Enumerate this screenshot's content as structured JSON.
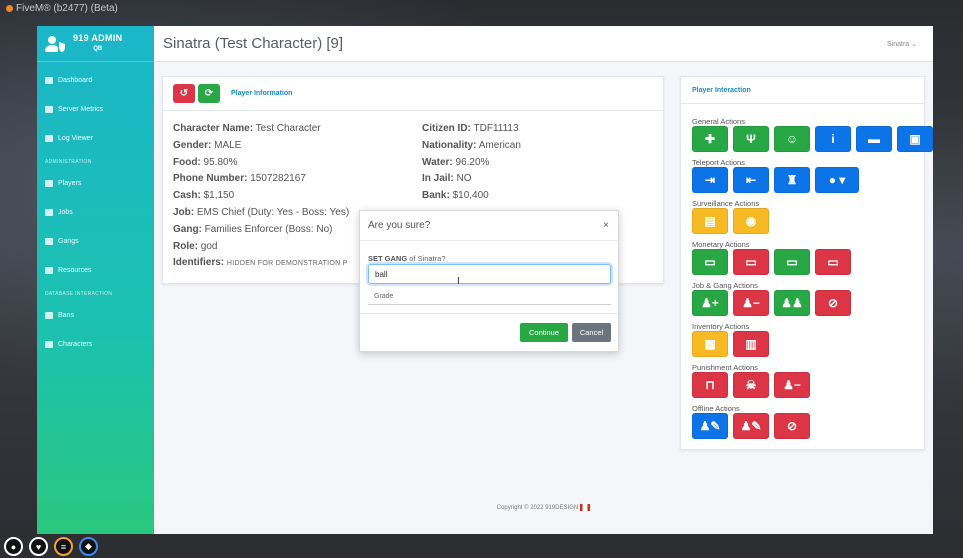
{
  "window_title": "FiveM® (b2477) (Beta)",
  "sidebar": {
    "brand_title": "919 ADMIN",
    "brand_sub": "QB",
    "items_top": [
      {
        "label": "Dashboard",
        "icon": "dashboard-icon"
      },
      {
        "label": "Server Metrics",
        "icon": "list-icon"
      },
      {
        "label": "Log Viewer",
        "icon": "file-icon"
      }
    ],
    "section_admin": "ADMINISTRATION",
    "items_admin": [
      {
        "label": "Players",
        "icon": "user-icon"
      },
      {
        "label": "Jobs",
        "icon": "briefcase-icon"
      },
      {
        "label": "Gangs",
        "icon": "users-icon"
      },
      {
        "label": "Resources",
        "icon": "folder-icon"
      }
    ],
    "section_db": "DATABASE INTERACTION",
    "items_db": [
      {
        "label": "Bans",
        "icon": "hammer-icon"
      },
      {
        "label": "Characters",
        "icon": "users-icon"
      }
    ]
  },
  "header": {
    "title": "Sinatra (Test Character) [9]",
    "user": "Sinatra"
  },
  "player_info": {
    "title": "Player Information",
    "left": [
      {
        "label": "Character Name:",
        "value": "Test Character"
      },
      {
        "label": "Gender:",
        "value": "MALE"
      },
      {
        "label": "Food:",
        "value": "95.80%"
      },
      {
        "label": "Phone Number:",
        "value": "1507282167"
      },
      {
        "label": "Cash:",
        "value": "$1,150"
      },
      {
        "label": "Job:",
        "value": "EMS Chief (Duty: Yes - Boss: Yes)"
      },
      {
        "label": "Gang:",
        "value": "Families Enforcer (Boss: No)"
      },
      {
        "label": "Role:",
        "value": "god"
      },
      {
        "label": "Identifiers:",
        "value": "HIDDEN FOR DEMONSTRATION P"
      }
    ],
    "right": [
      {
        "label": "Citizen ID:",
        "value": "TDF11113"
      },
      {
        "label": "Nationality:",
        "value": "American"
      },
      {
        "label": "Water:",
        "value": "96.20%"
      },
      {
        "label": "In Jail:",
        "value": "NO"
      },
      {
        "label": "Bank:",
        "value": "$10,400"
      }
    ]
  },
  "interaction": {
    "title": "Player Interaction",
    "groups": [
      {
        "label": "General Actions",
        "buttons": [
          {
            "icon": "medkit-icon",
            "color": "#28a745"
          },
          {
            "icon": "utensils-icon",
            "color": "#28a745"
          },
          {
            "icon": "smile-icon",
            "color": "#28a745"
          },
          {
            "icon": "info-icon",
            "color": "#0d74e8"
          },
          {
            "icon": "car-icon",
            "color": "#0d74e8"
          },
          {
            "icon": "save-icon",
            "color": "#0d74e8"
          }
        ]
      },
      {
        "label": "Teleport Actions",
        "buttons": [
          {
            "icon": "sign-in-icon",
            "color": "#0d74e8"
          },
          {
            "icon": "sign-out-icon",
            "color": "#0d74e8"
          },
          {
            "icon": "hiking-icon",
            "color": "#0d74e8"
          },
          {
            "icon": "map-pin-dropdown-icon",
            "color": "#0d74e8"
          }
        ]
      },
      {
        "label": "Surveillance Actions",
        "buttons": [
          {
            "icon": "file-icon",
            "color": "#f7b924"
          },
          {
            "icon": "eye-icon",
            "color": "#f7b924"
          }
        ]
      },
      {
        "label": "Monetary Actions",
        "buttons": [
          {
            "icon": "money-bill-icon",
            "color": "#28a745"
          },
          {
            "icon": "money-bill-icon",
            "color": "#dc3545"
          },
          {
            "icon": "money-check-icon",
            "color": "#28a745"
          },
          {
            "icon": "money-check-icon",
            "color": "#dc3545"
          }
        ]
      },
      {
        "label": "Job & Gang Actions",
        "buttons": [
          {
            "icon": "user-plus-icon",
            "color": "#28a745"
          },
          {
            "icon": "user-minus-icon",
            "color": "#dc3545"
          },
          {
            "icon": "users-icon",
            "color": "#28a745"
          },
          {
            "icon": "users-slash-icon",
            "color": "#dc3545"
          }
        ]
      },
      {
        "label": "Inventory Actions",
        "buttons": [
          {
            "icon": "boxes-icon",
            "color": "#f7b924"
          },
          {
            "icon": "trash-icon",
            "color": "#dc3545"
          }
        ]
      },
      {
        "label": "Punishment Actions",
        "buttons": [
          {
            "icon": "ban-icon",
            "color": "#dc3545"
          },
          {
            "icon": "skull-icon",
            "color": "#dc3545"
          },
          {
            "icon": "user-minus-icon",
            "color": "#dc3545"
          }
        ]
      },
      {
        "label": "Offline Actions",
        "buttons": [
          {
            "icon": "user-edit-icon",
            "color": "#0d74e8"
          },
          {
            "icon": "user-edit-icon",
            "color": "#dc3545"
          },
          {
            "icon": "user-slash-icon",
            "color": "#dc3545"
          }
        ]
      }
    ]
  },
  "modal": {
    "title": "Are you sure?",
    "close": "×",
    "action": "SET GANG",
    "question_rest": " of Sinatra?",
    "input_value": "ball",
    "select_placeholder": "Grade",
    "continue_label": "Continue",
    "cancel_label": "Cancel"
  },
  "footer": {
    "text": "Copyright © 2022 919DESIGN"
  }
}
